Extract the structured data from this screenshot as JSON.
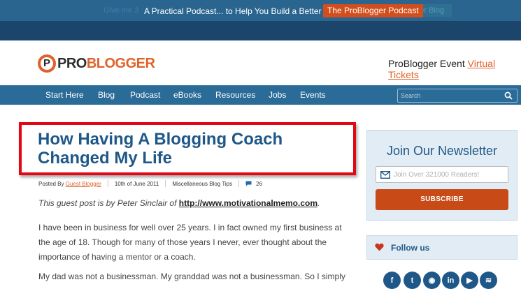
{
  "topbar": {
    "ghost_left": "Give me 3",
    "ghost_right": "etter Blog",
    "promo_text": "A Practical Podcast... to Help You Build a Better Blog",
    "promo_button": "The ProBlogger Podcast"
  },
  "header": {
    "logo_pro": "PRO",
    "logo_blogger": "BLOGGER",
    "event_text": "ProBlogger Event ",
    "event_link": "Virtual Tickets"
  },
  "nav": {
    "items": [
      "Start Here",
      "Blog",
      "Podcast",
      "eBooks",
      "Resources",
      "Jobs",
      "Events"
    ],
    "search_placeholder": "Search"
  },
  "article": {
    "title": "How Having A Blogging Coach Changed My Life",
    "posted_by_label": "Posted By",
    "author": "Guest Blogger",
    "date": "10th of June 2011",
    "category": "Miscellaneous Blog Tips",
    "comments": "26",
    "intro_text": "This guest post is by Peter Sinclair of ",
    "intro_link": "http://www.motivationalmemo.com",
    "intro_end": ".",
    "para2": "I have been in business for well over 25 years. I in fact owned my first business at the age of 18. Though for many of those years I never, ever thought about the importance of having a mentor or a coach.",
    "para3": "My dad was not a businessman. My granddad was not a businessman. So I simply"
  },
  "sidebar": {
    "newsletter_title": "Join Our Newsletter",
    "email_placeholder": "Join Over 321000 Readers!",
    "subscribe_label": "SUBSCRIBE",
    "follow_label": "Follow us",
    "social": [
      {
        "icon": "facebook-icon",
        "glyph": "f"
      },
      {
        "icon": "twitter-icon",
        "glyph": "t"
      },
      {
        "icon": "podcast-icon",
        "glyph": "◉"
      },
      {
        "icon": "linkedin-icon",
        "glyph": "in"
      },
      {
        "icon": "youtube-icon",
        "glyph": "▶"
      },
      {
        "icon": "rss-icon",
        "glyph": "≋"
      }
    ]
  },
  "colors": {
    "brand_orange": "#e0622a",
    "brand_blue": "#1f5888",
    "nav_blue": "#2a6b98",
    "highlight_red": "#e30613"
  }
}
